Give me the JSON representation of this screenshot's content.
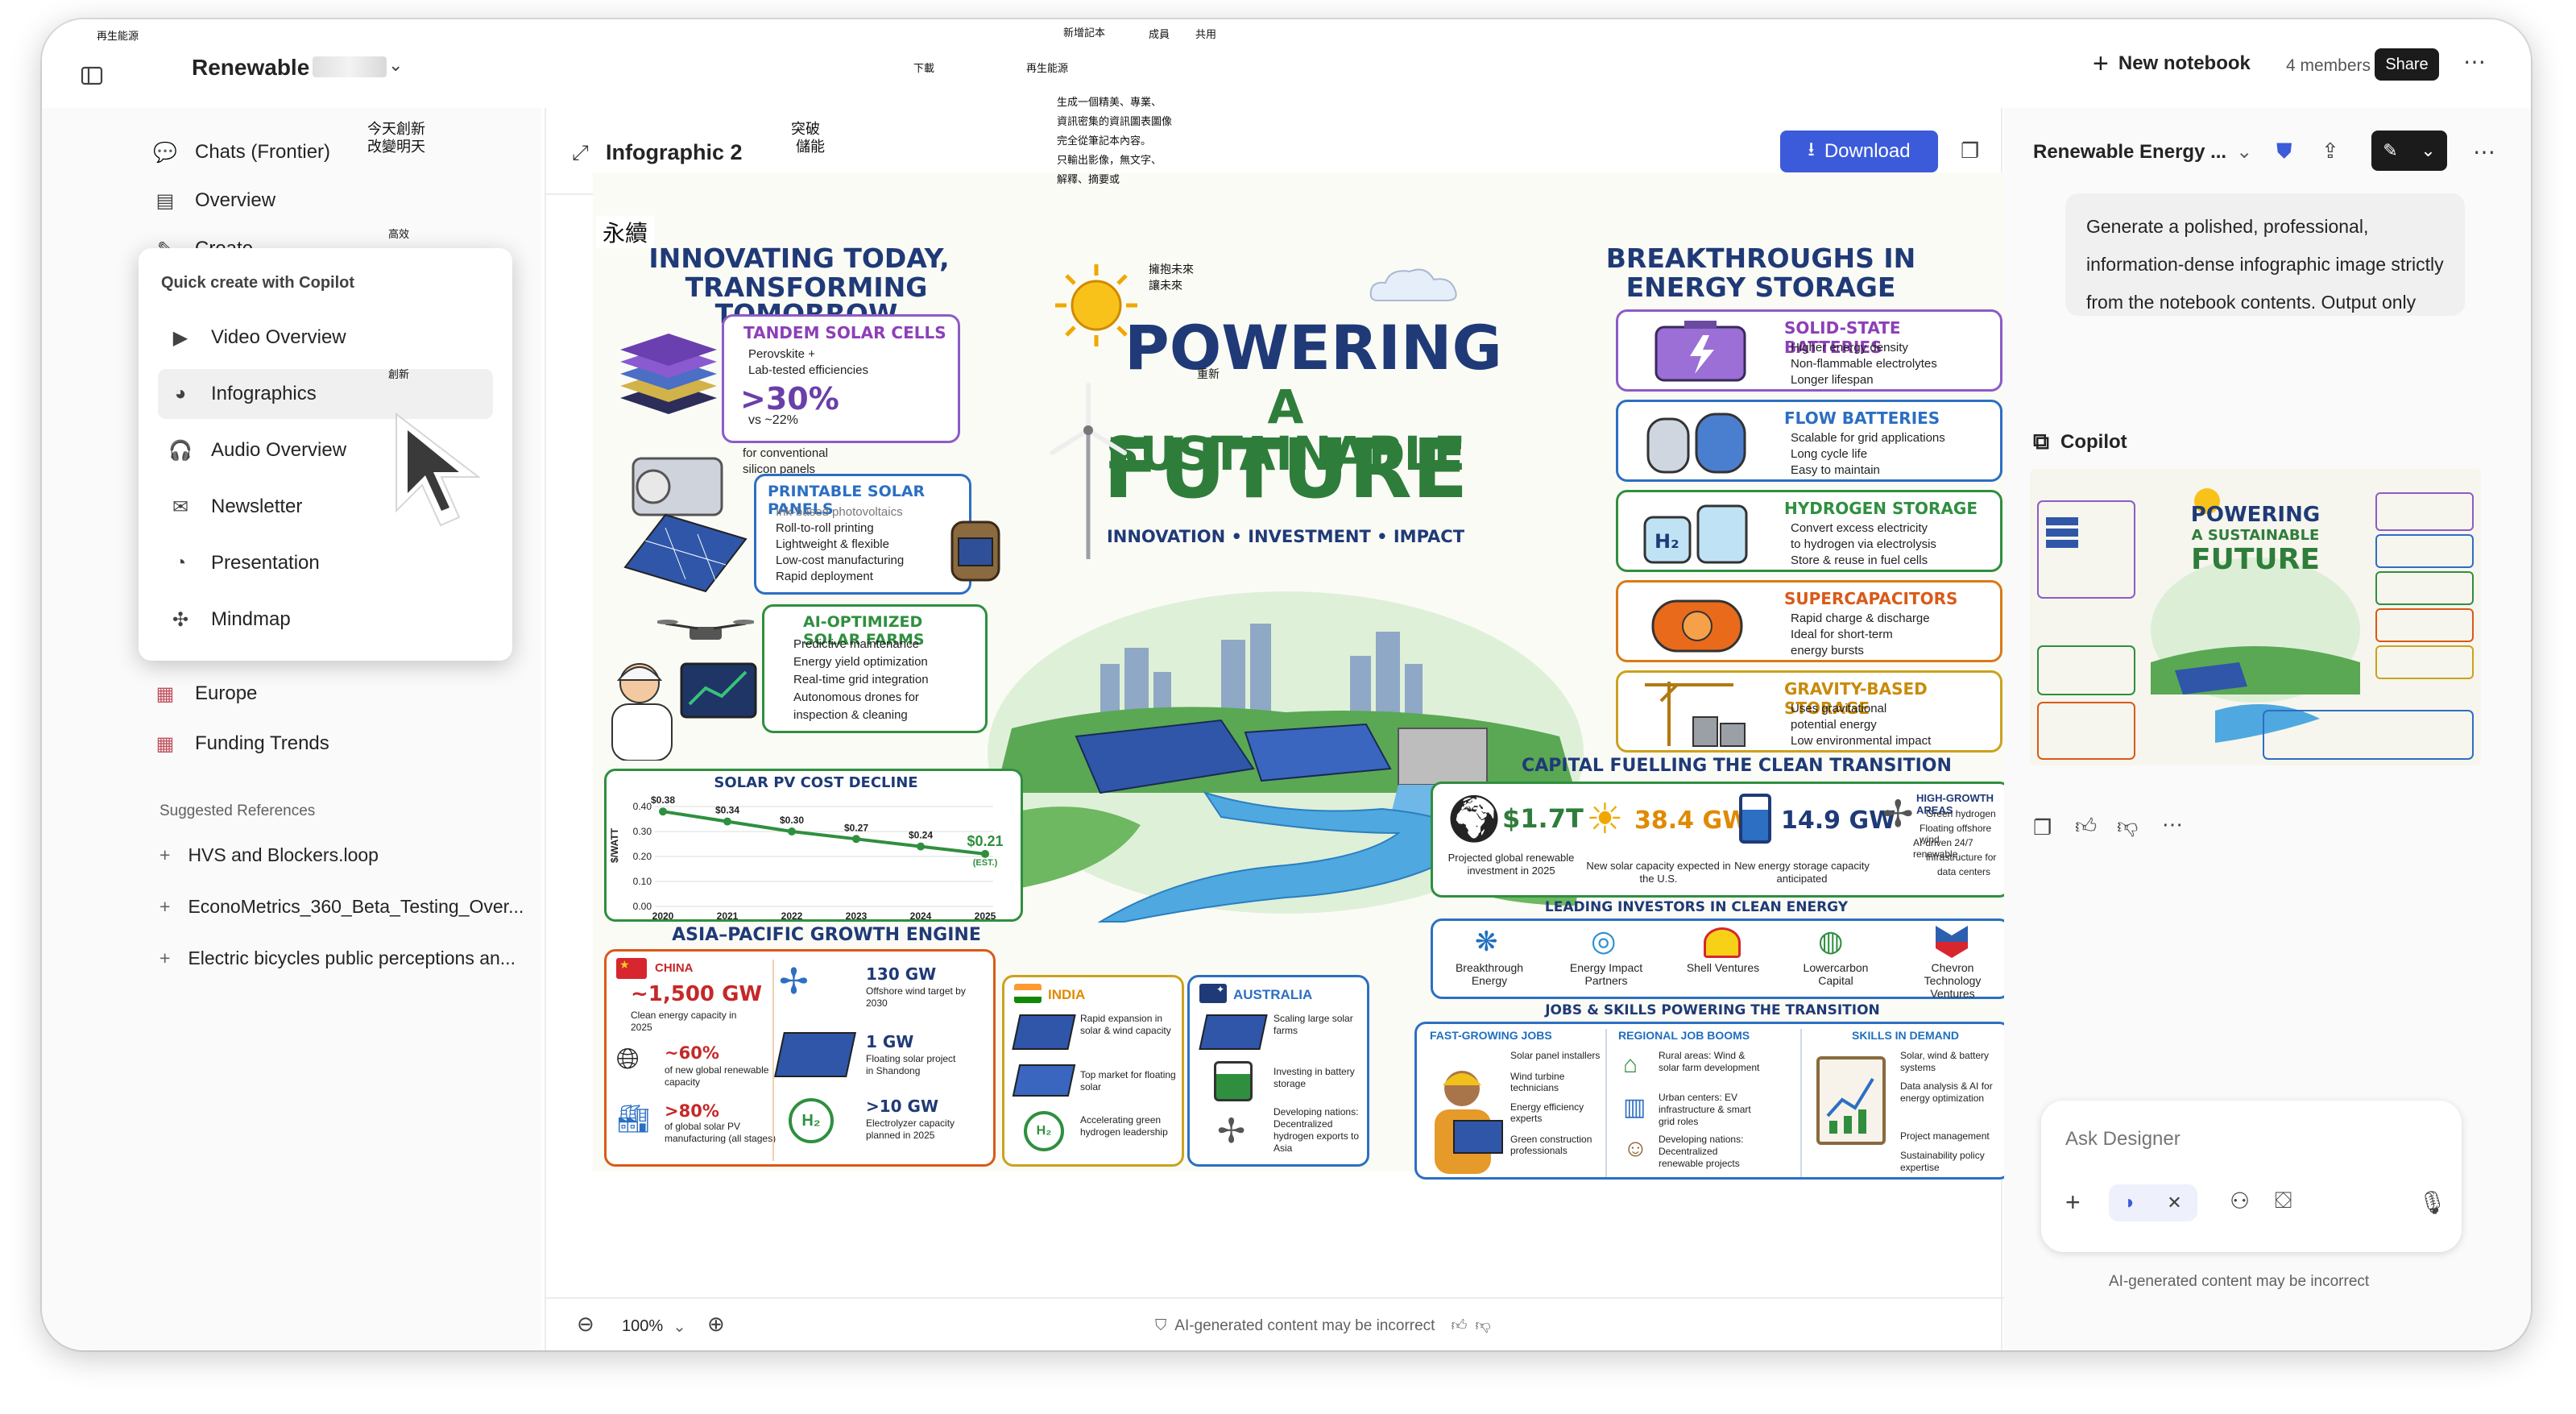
{
  "notebook": {
    "title": "Renewable",
    "new_notebook_label": "New notebook",
    "members": "4 members",
    "share_label": "Share"
  },
  "sidebar": {
    "items": [
      {
        "label": "Chats (Frontier)",
        "icon": "chat-icon"
      },
      {
        "label": "Overview",
        "icon": "overview-icon"
      },
      {
        "label": "Create",
        "icon": "create-icon"
      },
      {
        "label": "Europe",
        "icon": "page-icon"
      },
      {
        "label": "Funding Trends",
        "icon": "page-icon"
      }
    ],
    "suggested_heading": "Suggested References",
    "references": [
      "HVS and Blockers.loop",
      "EconoMetrics_360_Beta_Testing_Over...",
      "Electric bicycles public perceptions an..."
    ]
  },
  "quick_create": {
    "heading": "Quick create with Copilot",
    "items": [
      {
        "label": "Video Overview",
        "icon": "video-icon"
      },
      {
        "label": "Infographics",
        "icon": "infographic-icon"
      },
      {
        "label": "Audio Overview",
        "icon": "headphones-icon"
      },
      {
        "label": "Newsletter",
        "icon": "newsletter-icon"
      },
      {
        "label": "Presentation",
        "icon": "presentation-icon"
      },
      {
        "label": "Mindmap",
        "icon": "mindmap-icon"
      }
    ]
  },
  "canvas": {
    "title": "Infographic 2",
    "download_label": "Download",
    "zoom": "100%",
    "disclaimer": "AI-generated content may be incorrect"
  },
  "infographic": {
    "left_title_1": "INNOVATING TODAY,",
    "left_title_2": "TRANSFORMING TOMORROW",
    "tandem": {
      "title": "TANDEM SOLAR CELLS",
      "b1": "Perovskite +",
      "b2": "Lab-tested efficiencies",
      "big": ">30%",
      "vs": "vs ~22%",
      "vs2": "for conventional",
      "vs3": "silicon panels"
    },
    "printable": {
      "title": "PRINTABLE SOLAR PANELS",
      "b0": "Ink-based photovoltaics",
      "b1": "Roll-to-roll printing",
      "b2": "Lightweight & flexible",
      "b3": "Low-cost manufacturing",
      "b4": "Rapid deployment"
    },
    "ai_farms": {
      "title": "AI-OPTIMIZED SOLAR FARMS",
      "b1": "Predictive maintenance",
      "b2": "Energy yield optimization",
      "b3": "Real-time grid integration",
      "b4": "Autonomous drones for",
      "b5": "inspection & cleaning"
    },
    "center_1": "POWERING",
    "center_2": "A SUSTAINABLE",
    "center_3": "FUTURE",
    "center_sub": "INNOVATION • INVESTMENT • IMPACT",
    "right_title_1": "BREAKTHROUGHS IN",
    "right_title_2": "ENERGY STORAGE",
    "storage": [
      {
        "title": "SOLID-STATE BATTERIES",
        "b1": "Higher energy density",
        "b2": "Non-flammable electrolytes",
        "b3": "Longer lifespan"
      },
      {
        "title": "FLOW BATTERIES",
        "b1": "Scalable for grid applications",
        "b2": "Long cycle life",
        "b3": "Easy to maintain"
      },
      {
        "title": "HYDROGEN STORAGE",
        "b1": "Convert excess electricity",
        "b2": "to hydrogen via electrolysis",
        "b3": "Store & reuse in fuel cells"
      },
      {
        "title": "SUPERCAPACITORS",
        "b1": "Rapid charge & discharge",
        "b2": "Ideal for short-term",
        "b3": "energy bursts"
      },
      {
        "title": "GRAVITY-BASED STORAGE",
        "b1": "Uses gravitational",
        "b2": "potential energy",
        "b3": "Low environmental impact"
      }
    ],
    "capital_title": "CAPITAL FUELLING THE CLEAN TRANSITION",
    "capital": [
      {
        "value": "$1.7T",
        "label": "Projected global renewable investment in 2025"
      },
      {
        "value": "38.4 GW",
        "label": "New solar capacity expected in the U.S."
      },
      {
        "value": "14.9 GW",
        "label": "New energy storage capacity anticipated"
      }
    ],
    "high_growth": {
      "title": "HIGH-GROWTH AREAS",
      "b1": "Green hydrogen",
      "b2": "Floating offshore wind",
      "b3": "AI-driven 24/7 renewable",
      "b4": "infrastructure for",
      "b5": "data centers"
    },
    "investors_title": "LEADING INVESTORS IN CLEAN ENERGY",
    "investors": [
      "Breakthrough Energy",
      "Energy Impact Partners",
      "Shell Ventures",
      "Lowercarbon Capital",
      "Chevron Technology Ventures"
    ],
    "jobs_title": "JOBS & SKILLS POWERING THE TRANSITION",
    "jobs": {
      "fast_title": "FAST-GROWING JOBS",
      "f1": "Solar panel installers",
      "f2": "Wind turbine technicians",
      "f3": "Energy efficiency experts",
      "f4": "Green construction professionals",
      "regional_title": "REGIONAL JOB BOOMS",
      "r1": "Rural areas: Wind & solar farm development",
      "r2": "Urban centers: EV infrastructure & smart grid roles",
      "r3": "Developing nations: Decentralized renewable projects",
      "skills_title": "SKILLS IN DEMAND",
      "s1": "Solar, wind & battery systems",
      "s2": "Data analysis & AI for energy optimization",
      "s3": "Project management",
      "s4": "Sustainability policy expertise"
    },
    "pv_title": "SOLAR PV COST DECLINE",
    "apac_title": "ASIA–PACIFIC GROWTH ENGINE",
    "china": {
      "name": "CHINA",
      "v1": "~1,500 GW",
      "l1": "Clean energy capacity in 2025",
      "v2": "~60%",
      "l2": "of new global renewable capacity",
      "v3": ">80%",
      "l3": "of global solar PV manufacturing (all stages)",
      "v4": "130 GW",
      "l4": "Offshore wind target by 2030",
      "v5": "1 GW",
      "l5": "Floating solar project in Shandong",
      "v6": ">10 GW",
      "l6": "Electrolyzer capacity planned in 2025"
    },
    "india": {
      "name": "INDIA",
      "l1": "Rapid expansion in solar & wind capacity",
      "l2": "Top market for floating solar",
      "l3": "Accelerating green hydrogen leadership"
    },
    "australia": {
      "name": "AUSTRALIA",
      "l1": "Scaling large solar farms",
      "l2": "Investing in battery storage",
      "l3": "Developing nations: Decentralized hydrogen exports to Asia"
    }
  },
  "chart_data": {
    "type": "line",
    "title": "SOLAR PV COST DECLINE",
    "ylabel": "$/WATT",
    "x": [
      "2020",
      "2021",
      "2022",
      "2023",
      "2024",
      "2025"
    ],
    "values": [
      0.38,
      0.34,
      0.3,
      0.27,
      0.24,
      0.21
    ],
    "data_labels": [
      "$0.38",
      "$0.34",
      "$0.30",
      "$0.27",
      "$0.24",
      "$0.21"
    ],
    "last_note": "(EST.)",
    "yticks": [
      "0.40",
      "0.30",
      "0.20",
      "0.10",
      "0.00"
    ],
    "ylim": [
      0,
      0.4
    ],
    "color": "#2f8f3f"
  },
  "right_panel": {
    "title": "Renewable Energy ...",
    "prompt": "Generate a polished, professional, information-dense infographic image strictly from the notebook contents. Output only the image, with no text, explanations, summaries, or",
    "copilot_label": "Copilot",
    "thumb_title_1": "POWERING",
    "thumb_title_2": "A SUSTAINABLE",
    "thumb_title_3": "FUTURE",
    "ask_placeholder": "Ask Designer",
    "disclaimer": "AI-generated content may be incorrect"
  },
  "overlay_cjk": {
    "t1": "再生能源",
    "t2": "下載",
    "t3": "新增記本",
    "t4": "成員",
    "t5": "共用",
    "t6": "再生能源",
    "t7": "生成一個精美、專業、",
    "t8": "資訊密集的資訊圖表圖像",
    "t9": "完全從筆記本內容。",
    "t10": "只輸出影像，無文字、",
    "t11": "解釋、摘要或",
    "t12": "今天創新",
    "t13": "改變明天",
    "t14": "突破",
    "t15": "儲能",
    "t16": "永續",
    "t17": "擁抱未來",
    "t18": "讓未來",
    "t19": "重新",
    "t20": "高效",
    "t21": "創新"
  },
  "colors": {
    "accent": "#3b5bdb",
    "title_navy": "#1f3a77",
    "green": "#2f8f3f",
    "purple": "#7a5fb8"
  }
}
